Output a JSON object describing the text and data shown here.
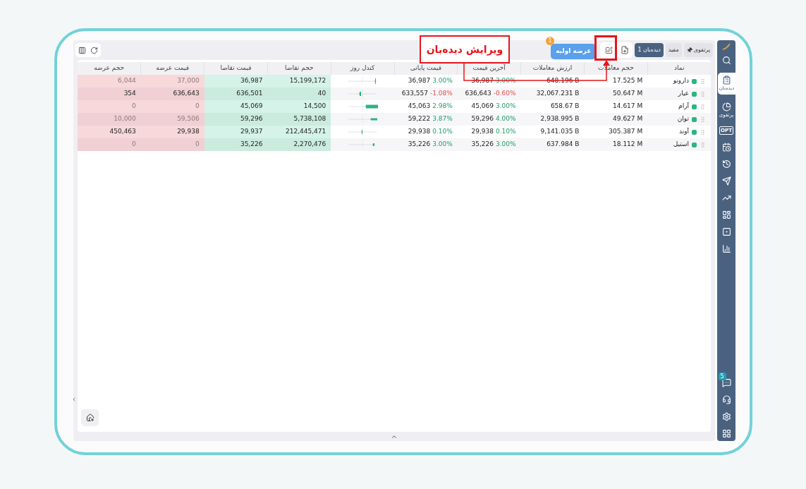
{
  "toolbar": {
    "tabs": [
      {
        "label": "پرتفوی",
        "pinned": true,
        "selected": false
      },
      {
        "label": "مفید",
        "pinned": false,
        "selected": false
      },
      {
        "label": "دیده‌بان 1",
        "pinned": false,
        "selected": true
      }
    ],
    "ipo_button": {
      "label": "عرضه اولیه",
      "badge": "1"
    }
  },
  "callout": {
    "label": "ویرایش دیده‌بان"
  },
  "table": {
    "columns": [
      "نماد",
      "حجم معاملات",
      "ارزش معاملات",
      "آخرین قیمت",
      "قیمت پایانی",
      "کندل روز",
      "حجم تقاضا",
      "قیمت تقاضا",
      "قیمت عرضه",
      "حجم عرضه"
    ],
    "rows": [
      {
        "symbol": "دارونو",
        "volume": "17.525 M",
        "value": "648.196 B",
        "last_price": "36,987",
        "last_change": "3.00%",
        "last_negative": false,
        "close_price": "36,987",
        "close_change": "3.00%",
        "close_negative": false,
        "bid_volume": "15,199,172",
        "bid_price": "36,987",
        "ask_price": "37,000",
        "ask_volume": "6,044",
        "ask_muted": true
      },
      {
        "symbol": "عیار",
        "volume": "50.647 M",
        "value": "32,067.231 B",
        "last_price": "636,643",
        "last_change": "-0.60%",
        "last_negative": true,
        "close_price": "633,557",
        "close_change": "-1.08%",
        "close_negative": true,
        "bid_volume": "40",
        "bid_price": "636,501",
        "ask_price": "636,643",
        "ask_volume": "354",
        "ask_muted": false
      },
      {
        "symbol": "آرام",
        "volume": "14.617 M",
        "value": "658.67 B",
        "last_price": "45,069",
        "last_change": "3.00%",
        "last_negative": false,
        "close_price": "45,063",
        "close_change": "2.98%",
        "close_negative": false,
        "bid_volume": "14,500",
        "bid_price": "45,069",
        "ask_price": "0",
        "ask_volume": "0",
        "ask_muted": true
      },
      {
        "symbol": "توان",
        "volume": "49.627 M",
        "value": "2,938.995 B",
        "last_price": "59,296",
        "last_change": "4.00%",
        "last_negative": false,
        "close_price": "59,222",
        "close_change": "3.87%",
        "close_negative": false,
        "bid_volume": "5,738,108",
        "bid_price": "59,296",
        "ask_price": "59,506",
        "ask_volume": "10,000",
        "ask_muted": true
      },
      {
        "symbol": "آوند",
        "volume": "305.387 M",
        "value": "9,141.035 B",
        "last_price": "29,938",
        "last_change": "0.10%",
        "last_negative": false,
        "close_price": "29,938",
        "close_change": "0.10%",
        "close_negative": false,
        "bid_volume": "212,445,471",
        "bid_price": "29,937",
        "ask_price": "29,938",
        "ask_volume": "450,463",
        "ask_muted": false
      },
      {
        "symbol": "استیل",
        "volume": "18.112 M",
        "value": "637.984 B",
        "last_price": "35,226",
        "last_change": "3.00%",
        "last_negative": false,
        "close_price": "35,226",
        "close_change": "3.00%",
        "close_negative": false,
        "bid_volume": "2,270,476",
        "bid_price": "35,226",
        "ask_price": "0",
        "ask_volume": "0",
        "ask_muted": true
      }
    ]
  },
  "sidebar": {
    "items": [
      {
        "selected": false
      },
      {
        "label": "دیده‌بان",
        "selected": true
      },
      {
        "label": "پرتفوی",
        "selected": false
      },
      {
        "text": "OPT",
        "selected": false
      },
      {
        "selected": false
      },
      {
        "selected": false
      },
      {
        "selected": false
      },
      {
        "selected": false
      },
      {
        "selected": false
      },
      {
        "selected": false
      },
      {
        "selected": false
      }
    ],
    "bottom_items": [
      {
        "kind": "chat",
        "badge": "5"
      },
      {
        "kind": "support"
      },
      {
        "kind": "settings"
      },
      {
        "kind": "apps"
      }
    ]
  }
}
